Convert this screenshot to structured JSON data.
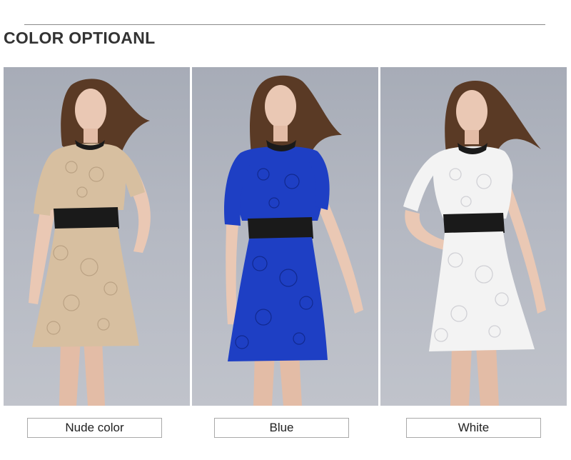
{
  "section_title": "COLOR OPTIOANL",
  "options": [
    {
      "label": "Nude color",
      "swatch": "#d7bfa0",
      "lace_dark": "#b39a7c"
    },
    {
      "label": "Blue",
      "swatch": "#1e3fc4",
      "lace_dark": "#10278a"
    },
    {
      "label": "White",
      "swatch": "#f3f3f3",
      "lace_dark": "#cfcfd4"
    }
  ],
  "colors": {
    "background_panel": "#b4b8c2",
    "belt": "#1a1a1a",
    "hair": "#5a3a25",
    "skin": "#eac8b4"
  }
}
